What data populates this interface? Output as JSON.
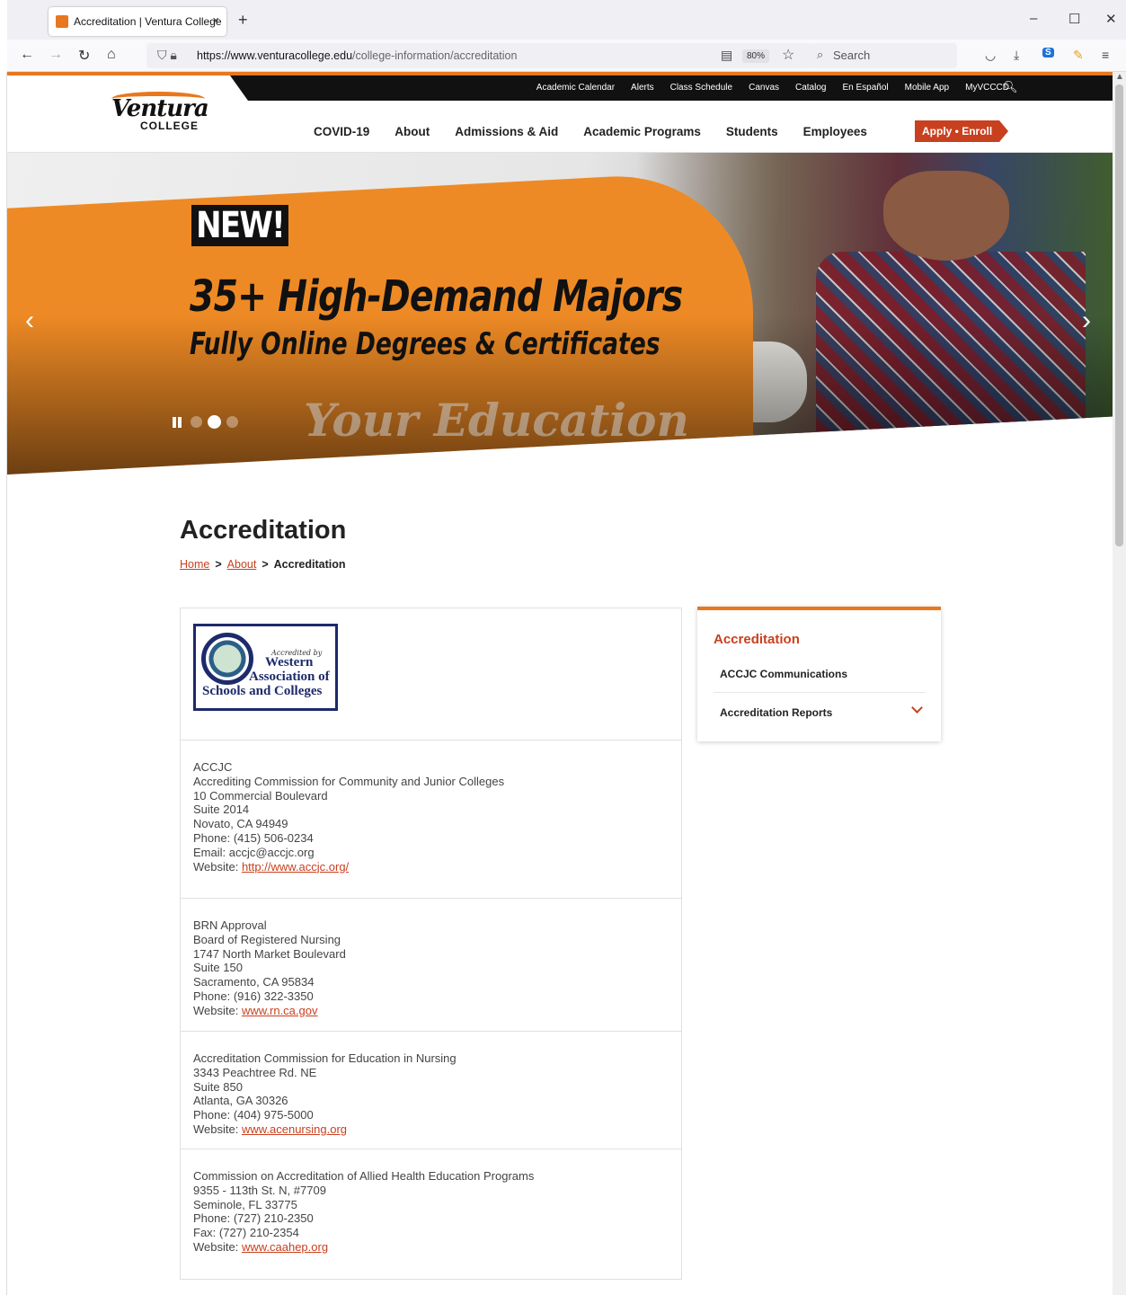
{
  "browser": {
    "tab_title": "Accreditation | Ventura College",
    "tab_close": "×",
    "new_tab": "+",
    "url_host": "https://www.venturacollege.edu",
    "url_path": "/college-information/accreditation",
    "zoom": "80%",
    "search_placeholder": "Search",
    "window_min": "–",
    "window_max": "☐",
    "window_close": "✕"
  },
  "site": {
    "logo_script": "Ventura",
    "logo_sub": "COLLEGE",
    "util_links": [
      "Academic Calendar",
      "Alerts",
      "Class Schedule",
      "Canvas",
      "Catalog",
      "En Español",
      "Mobile App",
      "MyVCCCD"
    ],
    "main_nav": [
      "COVID-19",
      "About",
      "Admissions & Aid",
      "Academic Programs",
      "Students",
      "Employees"
    ],
    "apply_button": "Apply • Enroll",
    "colors": {
      "accent": "#e8771e",
      "brand_red": "#c9401f"
    }
  },
  "hero": {
    "badge": "NEW!",
    "headline": "35+ High-Demand Majors",
    "subheadline": "Fully Online Degrees & Certificates",
    "watermark": "Your Education",
    "slides_total": 3,
    "active_slide": 2
  },
  "page": {
    "title": "Accreditation",
    "breadcrumb": {
      "home": "Home",
      "about": "About",
      "current": "Accreditation",
      "sep": ">"
    }
  },
  "wasc": {
    "accredited_by": "Accredited by",
    "line1": "Western",
    "line2": "Association of",
    "line3": "Schools and Colleges"
  },
  "cards": [
    {
      "lines": [
        "ACCJC",
        "Accrediting Commission for Community and Junior Colleges",
        "10 Commercial Boulevard",
        "Suite 2014",
        "Novato, CA 94949",
        "Phone: (415) 506-0234",
        "Email: accjc@accjc.org"
      ],
      "website_label": "Website: ",
      "website": "http://www.accjc.org/"
    },
    {
      "lines": [
        "BRN Approval",
        "Board of Registered Nursing",
        "1747 North Market Boulevard",
        "Suite 150",
        "Sacramento, CA 95834",
        "Phone: (916) 322-3350"
      ],
      "website_label": "Website: ",
      "website": "www.rn.ca.gov"
    },
    {
      "lines": [
        "Accreditation Commission for Education in  Nursing",
        "3343 Peachtree Rd. NE",
        "Suite 850",
        "Atlanta, GA 30326",
        "Phone: (404) 975-5000"
      ],
      "website_label": "Website: ",
      "website": "www.acenursing.org"
    },
    {
      "lines": [
        "Commission on Accreditation of Allied Health Education Programs",
        "9355 - 113th St. N, #7709",
        "Seminole, FL 33775",
        "Phone: (727) 210-2350",
        "Fax: (727) 210-2354"
      ],
      "website_label": "Website: ",
      "website": "www.caahep.org"
    }
  ],
  "sidebar": {
    "title": "Accreditation",
    "items": [
      "ACCJC Communications",
      "Accreditation Reports"
    ]
  }
}
